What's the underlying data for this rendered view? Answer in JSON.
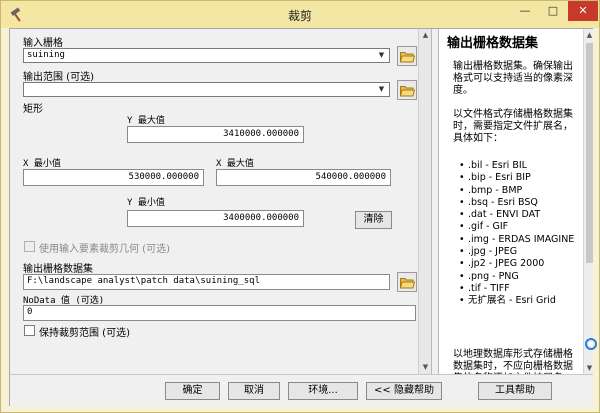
{
  "window": {
    "title": "裁剪",
    "minimize_label": "—",
    "maximize_label": "□",
    "close_label": "✕"
  },
  "form": {
    "input_raster_label": "输入栅格",
    "input_raster_value": "suining",
    "output_extent_label": "输出范围 (可选)",
    "output_extent_value": "",
    "rectangle_label": "矩形",
    "y_max_label": "Y 最大值",
    "y_max_value": "3410000.000000",
    "x_min_label": "X 最小值",
    "x_min_value": "530000.000000",
    "x_max_label": "X 最大值",
    "x_max_value": "540000.000000",
    "y_min_label": "Y 最小值",
    "y_min_value": "3400000.000000",
    "clear_button": "清除",
    "use_geometry_label": "使用输入要素裁剪几何 (可选)",
    "output_raster_label": "输出栅格数据集",
    "output_raster_value": "F:\\landscape analyst\\patch data\\suining_sql",
    "nodata_label": "NoData 值 (可选)",
    "nodata_value": "0",
    "maintain_extent_label": "保持裁剪范围 (可选)"
  },
  "help": {
    "title": "输出栅格数据集",
    "para1": "输出栅格数据集。确保输出格式可以支持适当的像素深度。",
    "para2": "以文件格式存储栅格数据集时，需要指定文件扩展名，具体如下：",
    "list": [
      ".bil - Esri BIL",
      ".bip - Esri BIP",
      ".bmp - BMP",
      ".bsq - Esri BSQ",
      ".dat - ENVI DAT",
      ".gif - GIF",
      ".img - ERDAS IMAGINE",
      ".jpg - JPEG",
      ".jp2 - JPEG 2000",
      ".png - PNG",
      ".tif - TIFF",
      "无扩展名 - Esri Grid"
    ],
    "para3": "以地理数据库形式存储栅格数据集时，不应向栅格数据集的名称添加文件扩展名。"
  },
  "footer": {
    "ok_button": "确定",
    "cancel_button": "取消",
    "env_button": "环境...",
    "hide_help_button": "<< 隐藏帮助",
    "tool_help_button": "工具帮助"
  },
  "colors": {
    "titlebar": "#f3e7a3",
    "close_button": "#c7392a"
  }
}
